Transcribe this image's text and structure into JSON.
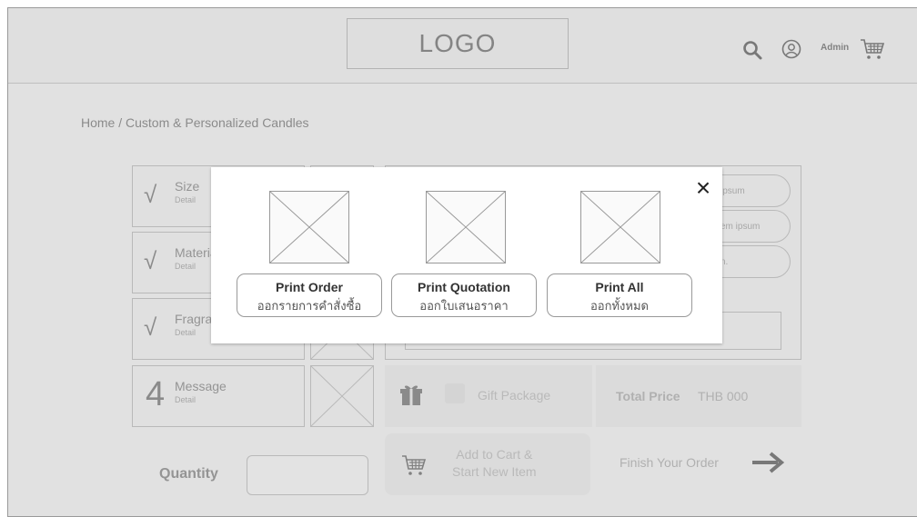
{
  "header": {
    "logo_text": "LOGO",
    "admin_label": "Admin",
    "icons": [
      "search-icon",
      "user-icon",
      "cart-icon"
    ]
  },
  "breadcrumb": "Home / Custom & Personalized Candles",
  "options": [
    {
      "title": "Size",
      "detail": "Detail",
      "marker": "check"
    },
    {
      "title": "Material",
      "detail": "Detail",
      "marker": "check"
    },
    {
      "title": "Fragrance",
      "detail": "Detail",
      "marker": "check"
    },
    {
      "title": "Message",
      "detail": "Detail",
      "marker": "4"
    }
  ],
  "check_mark": "√",
  "message_step_number": "4",
  "pills": [
    "ipsum",
    "em ipsum",
    "n."
  ],
  "gift": {
    "label": "Gift Package"
  },
  "total": {
    "label": "Total Price",
    "value": "THB 000"
  },
  "quantity": {
    "label": "Quantity",
    "value": ""
  },
  "add_to_cart": {
    "line1": "Add to Cart &",
    "line2": "Start New Item"
  },
  "finish": {
    "label": "Finish Your Order"
  },
  "modal": {
    "close_symbol": "×",
    "buttons": [
      {
        "title": "Print Order",
        "subtitle": "ออกรายการคำสั่งซื้อ"
      },
      {
        "title": "Print Quotation",
        "subtitle": "ออกใบเสนอราคา"
      },
      {
        "title": "Print All",
        "subtitle": "ออกทั้งหมด"
      }
    ]
  },
  "colors": {
    "overlay": "#cdcdcd",
    "modal_bg": "#ffffff",
    "page_bg": "#f3f3f3"
  }
}
